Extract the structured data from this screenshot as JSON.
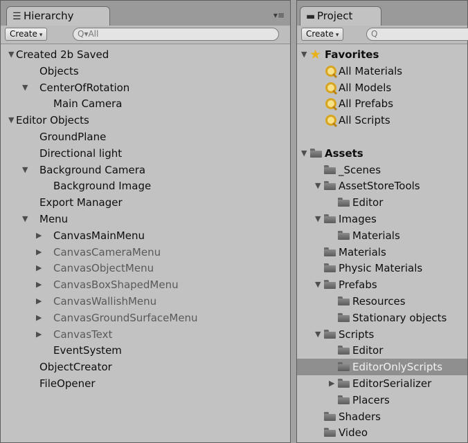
{
  "hierarchy": {
    "tab_label": "Hierarchy",
    "tab_icon": "hierarchy-list-icon",
    "menu_icon": "▾≡",
    "create_label": "Create",
    "search_value": "All",
    "search_prefix": "Q▾",
    "rows": [
      {
        "label": "Created 2b Saved",
        "depth": 0,
        "fold": "open",
        "dim": false
      },
      {
        "label": "Objects",
        "depth": 1,
        "fold": "none",
        "dim": false
      },
      {
        "label": "CenterOfRotation",
        "depth": 1,
        "fold": "open",
        "dim": false
      },
      {
        "label": "Main Camera",
        "depth": 2,
        "fold": "none",
        "dim": false
      },
      {
        "label": "Editor Objects",
        "depth": 0,
        "fold": "open",
        "dim": false
      },
      {
        "label": "GroundPlane",
        "depth": 1,
        "fold": "none",
        "dim": false
      },
      {
        "label": "Directional light",
        "depth": 1,
        "fold": "none",
        "dim": false
      },
      {
        "label": "Background Camera",
        "depth": 1,
        "fold": "open",
        "dim": false
      },
      {
        "label": "Background Image",
        "depth": 2,
        "fold": "none",
        "dim": false
      },
      {
        "label": "Export Manager",
        "depth": 1,
        "fold": "none",
        "dim": false
      },
      {
        "label": "Menu",
        "depth": 1,
        "fold": "open",
        "dim": false
      },
      {
        "label": "CanvasMainMenu",
        "depth": 2,
        "fold": "closed",
        "dim": false
      },
      {
        "label": "CanvasCameraMenu",
        "depth": 2,
        "fold": "closed",
        "dim": true
      },
      {
        "label": "CanvasObjectMenu",
        "depth": 2,
        "fold": "closed",
        "dim": true
      },
      {
        "label": "CanvasBoxShapedMenu",
        "depth": 2,
        "fold": "closed",
        "dim": true
      },
      {
        "label": "CanvasWallishMenu",
        "depth": 2,
        "fold": "closed",
        "dim": true
      },
      {
        "label": "CanvasGroundSurfaceMenu",
        "depth": 2,
        "fold": "closed",
        "dim": true
      },
      {
        "label": "CanvasText",
        "depth": 2,
        "fold": "closed",
        "dim": true
      },
      {
        "label": "EventSystem",
        "depth": 2,
        "fold": "none",
        "dim": false
      },
      {
        "label": "ObjectCreator",
        "depth": 1,
        "fold": "none",
        "dim": false
      },
      {
        "label": "FileOpener",
        "depth": 1,
        "fold": "none",
        "dim": false
      }
    ]
  },
  "project": {
    "tab_label": "Project",
    "tab_icon": "folder-icon",
    "create_label": "Create",
    "search_prefix": "Q",
    "rows": [
      {
        "label": "Favorites",
        "depth": 0,
        "fold": "open",
        "icon": "star-icon",
        "bold": true,
        "selected": false
      },
      {
        "label": "All Materials",
        "depth": 1,
        "fold": "none",
        "icon": "search-icon",
        "bold": false,
        "selected": false
      },
      {
        "label": "All Models",
        "depth": 1,
        "fold": "none",
        "icon": "search-icon",
        "bold": false,
        "selected": false
      },
      {
        "label": "All Prefabs",
        "depth": 1,
        "fold": "none",
        "icon": "search-icon",
        "bold": false,
        "selected": false
      },
      {
        "label": "All Scripts",
        "depth": 1,
        "fold": "none",
        "icon": "search-icon",
        "bold": false,
        "selected": false
      },
      {
        "label": "",
        "depth": 0,
        "fold": "none",
        "icon": "",
        "bold": false,
        "selected": false
      },
      {
        "label": "Assets",
        "depth": 0,
        "fold": "open",
        "icon": "folder-icon",
        "bold": true,
        "selected": false
      },
      {
        "label": "_Scenes",
        "depth": 1,
        "fold": "none",
        "icon": "folder-icon",
        "bold": false,
        "selected": false
      },
      {
        "label": "AssetStoreTools",
        "depth": 1,
        "fold": "open",
        "icon": "folder-icon",
        "bold": false,
        "selected": false
      },
      {
        "label": "Editor",
        "depth": 2,
        "fold": "none",
        "icon": "folder-icon",
        "bold": false,
        "selected": false
      },
      {
        "label": "Images",
        "depth": 1,
        "fold": "open",
        "icon": "folder-icon",
        "bold": false,
        "selected": false
      },
      {
        "label": "Materials",
        "depth": 2,
        "fold": "none",
        "icon": "folder-icon",
        "bold": false,
        "selected": false
      },
      {
        "label": "Materials",
        "depth": 1,
        "fold": "none",
        "icon": "folder-icon",
        "bold": false,
        "selected": false
      },
      {
        "label": "Physic Materials",
        "depth": 1,
        "fold": "none",
        "icon": "folder-icon",
        "bold": false,
        "selected": false
      },
      {
        "label": "Prefabs",
        "depth": 1,
        "fold": "open",
        "icon": "folder-icon",
        "bold": false,
        "selected": false
      },
      {
        "label": "Resources",
        "depth": 2,
        "fold": "none",
        "icon": "folder-icon",
        "bold": false,
        "selected": false
      },
      {
        "label": "Stationary objects",
        "depth": 2,
        "fold": "none",
        "icon": "folder-icon",
        "bold": false,
        "selected": false
      },
      {
        "label": "Scripts",
        "depth": 1,
        "fold": "open",
        "icon": "folder-icon",
        "bold": false,
        "selected": false
      },
      {
        "label": "Editor",
        "depth": 2,
        "fold": "none",
        "icon": "folder-icon",
        "bold": false,
        "selected": false
      },
      {
        "label": "EditorOnlyScripts",
        "depth": 2,
        "fold": "none",
        "icon": "folder-icon",
        "bold": false,
        "selected": true
      },
      {
        "label": "EditorSerializer",
        "depth": 2,
        "fold": "closed",
        "icon": "folder-icon",
        "bold": false,
        "selected": false
      },
      {
        "label": "Placers",
        "depth": 2,
        "fold": "none",
        "icon": "folder-icon",
        "bold": false,
        "selected": false
      },
      {
        "label": "Shaders",
        "depth": 1,
        "fold": "none",
        "icon": "folder-icon",
        "bold": false,
        "selected": false
      },
      {
        "label": "Video",
        "depth": 1,
        "fold": "none",
        "icon": "folder-icon",
        "bold": false,
        "selected": false
      }
    ]
  }
}
